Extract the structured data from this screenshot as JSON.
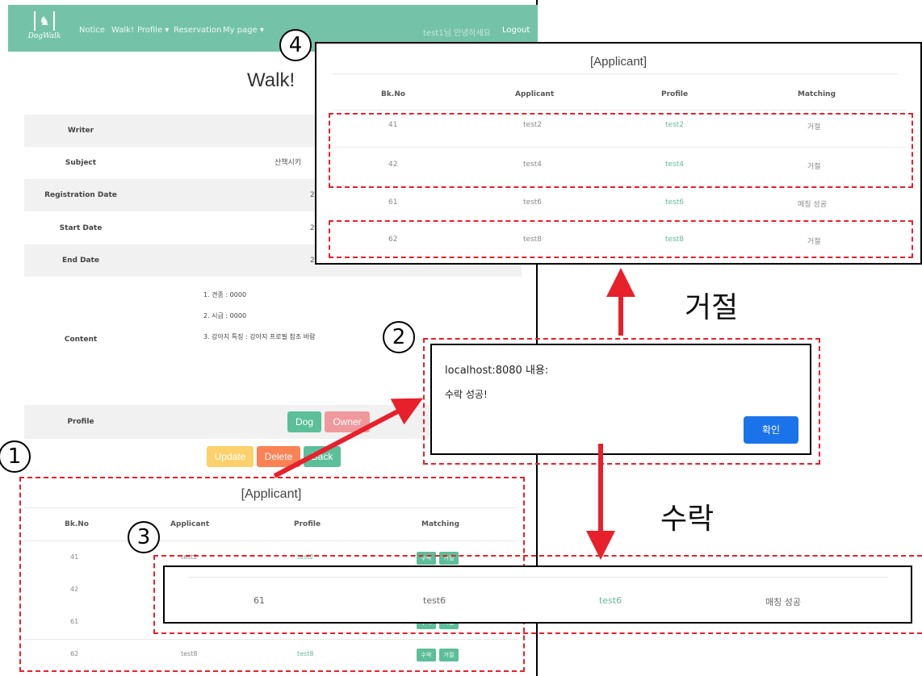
{
  "navbar": {
    "logo_text": "DogWalk",
    "items": [
      "Notice",
      "Walk!",
      "Profile ▾",
      "Reservation",
      "My page ▾"
    ],
    "greeting": "test1님 안녕하세요",
    "logout": "Logout"
  },
  "page": {
    "title": "Walk!",
    "rows": [
      {
        "label": "Writer",
        "value": ""
      },
      {
        "label": "Subject",
        "value": "산책시키"
      },
      {
        "label": "Registration Date",
        "value": "2"
      },
      {
        "label": "Start Date",
        "value": "2"
      },
      {
        "label": "End Date",
        "value": "2"
      }
    ],
    "content_label": "Content",
    "content_lines": [
      "1. 견종 : 0000",
      "2. 시급 : 0000",
      "3. 강아지 특징 : 강아지 프로필 참조 바람"
    ],
    "profile_label": "Profile",
    "profile_buttons": {
      "dog": "Dog",
      "owner": "Owner"
    },
    "actions": {
      "update": "Update",
      "delete": "Delete",
      "back": "Back"
    }
  },
  "applicant_table": {
    "title": "[Applicant]",
    "headers": [
      "Bk.No",
      "Applicant",
      "Profile",
      "Matching"
    ],
    "rows": [
      {
        "bk": "41",
        "applicant": "test2",
        "profile": "test2"
      },
      {
        "bk": "42",
        "applicant": "test4",
        "profile": "test4"
      },
      {
        "bk": "61",
        "applicant": "test6",
        "profile": "test6"
      },
      {
        "bk": "62",
        "applicant": "test8",
        "profile": "test8"
      }
    ],
    "accept_label": "수락",
    "reject_label": "거절"
  },
  "panel_after_reject": {
    "title": "[Applicant]",
    "headers": [
      "Bk.No",
      "Applicant",
      "Profile",
      "Matching"
    ],
    "rows": [
      {
        "bk": "41",
        "applicant": "test2",
        "profile": "test2",
        "matching": "거절"
      },
      {
        "bk": "42",
        "applicant": "test4",
        "profile": "test4",
        "matching": "거절"
      },
      {
        "bk": "61",
        "applicant": "test6",
        "profile": "test6",
        "matching": "매칭 성공"
      },
      {
        "bk": "62",
        "applicant": "test8",
        "profile": "test8",
        "matching": "거절"
      }
    ]
  },
  "dialog": {
    "origin": "localhost:8080 내용:",
    "message": "수락 성공!",
    "ok": "확인"
  },
  "result_strip": {
    "bk": "61",
    "applicant": "test6",
    "profile": "test6",
    "matching": "매칭 성공"
  },
  "annotations": {
    "numbers": [
      "1",
      "2",
      "3",
      "4"
    ],
    "reject_caption": "거절",
    "accept_caption": "수락"
  },
  "colors": {
    "navbar": "#74c3a8",
    "accent_green": "#5bbf9a",
    "owner_pink": "#f0999d",
    "update_yellow": "#fcd06a",
    "delete_orange": "#fb8255",
    "annotation_red": "#e8202b",
    "dialog_button": "#1a73e8"
  }
}
